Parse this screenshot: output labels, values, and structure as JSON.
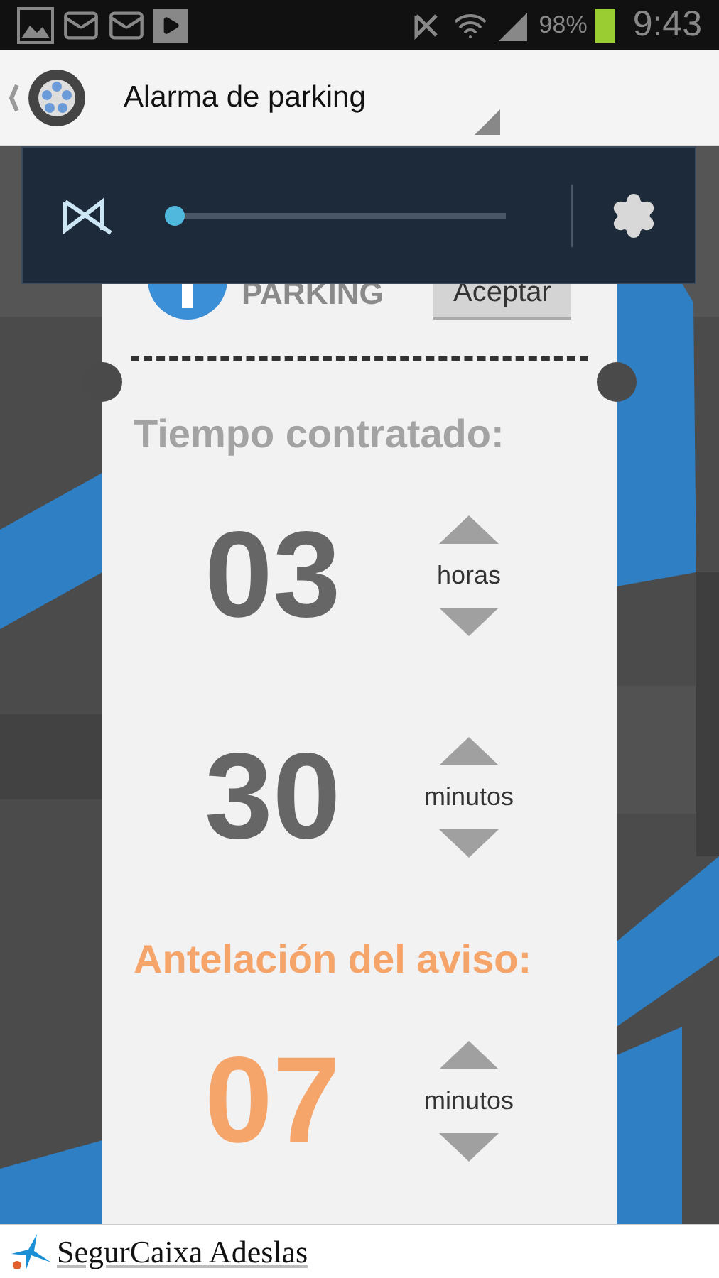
{
  "status_bar": {
    "battery": "98%",
    "time": "9:43"
  },
  "action_bar": {
    "title": "Alarma de parking"
  },
  "volume_popup": {
    "level": 0
  },
  "ticket": {
    "logo_text": "PARKING",
    "accept_button": "Aceptar",
    "sections": [
      {
        "heading": "Tiempo contratado:",
        "kind": "duration",
        "rows": [
          {
            "value": "03",
            "unit": "horas"
          },
          {
            "value": "30",
            "unit": "minutos"
          }
        ]
      },
      {
        "heading": "Antelación del aviso:",
        "kind": "warning",
        "rows": [
          {
            "value": "07",
            "unit": "minutos"
          }
        ]
      }
    ]
  },
  "footer": {
    "brand": "SegurCaixa Adeslas"
  }
}
